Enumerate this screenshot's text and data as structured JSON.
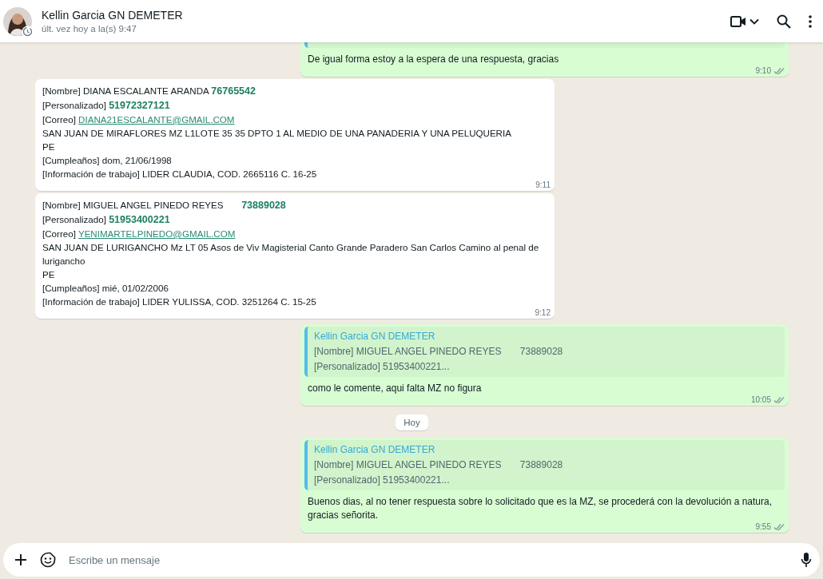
{
  "header": {
    "name": "Kellin Garcia GN DEMETER",
    "status": "últ. vez hoy a la(s) 9:47"
  },
  "messages": [
    {
      "kind": "message",
      "outgoing": true,
      "quote": {
        "partial": true
      },
      "lines": [
        {
          "text": "De igual forma estoy a la espera de una respuesta, gracias"
        }
      ],
      "time": "9:10",
      "read": false
    },
    {
      "kind": "message",
      "outgoing": false,
      "lines": [
        {
          "text": "[Nombre] DIANA ESCALANTE ARANDA **76765542**"
        },
        {
          "text": "[Personalizado] **51972327121**"
        },
        {
          "text": "[Correo] ",
          "link": "DIANA21ESCALANTE@GMAIL.COM"
        },
        {
          "text": "SAN JUAN DE MIRAFLORES MZ L1LOTE 35 35 DPTO 1 AL MEDIO DE UNA PANADERIA Y UNA PELUQUERIA"
        },
        {
          "text": "PE"
        },
        {
          "text": "[Cumpleaños] dom, 21/06/1998"
        },
        {
          "text": "[Información de trabajo] LIDER CLAUDIA, COD. 2665116 C. 16-25"
        }
      ],
      "time": "9:11"
    },
    {
      "kind": "message",
      "outgoing": false,
      "lines": [
        {
          "text": "[Nombre] MIGUEL ANGEL PINEDO REYES       **73889028**"
        },
        {
          "text": "[Personalizado] **51953400221**"
        },
        {
          "text": "[Correo] ",
          "link": "YENIMARTELPINEDO@GMAIL.COM"
        },
        {
          "text": "SAN JUAN DE LURIGANCHO Mz LT 05 Asos de Viv Magisterial Canto Grande Paradero San Carlos Camino al penal de lurigancho"
        },
        {
          "text": "PE"
        },
        {
          "text": "[Cumpleaños] mié, 01/02/2006"
        },
        {
          "text": "[Información de trabajo] LIDER YULISSA, COD. 3251264 C. 15-25"
        }
      ],
      "time": "9:12"
    },
    {
      "kind": "message",
      "outgoing": true,
      "quote": {
        "author": "Kellin Garcia GN DEMETER",
        "lines": [
          "[Nombre] MIGUEL ANGEL PINEDO REYES       73889028",
          "[Personalizado] 51953400221..."
        ]
      },
      "lines": [
        {
          "text": "como le comente, aqui falta MZ no figura"
        }
      ],
      "time": "10:05",
      "read": false
    },
    {
      "kind": "date",
      "label": "Hoy"
    },
    {
      "kind": "message",
      "outgoing": true,
      "quote": {
        "author": "Kellin Garcia GN DEMETER",
        "lines": [
          "[Nombre] MIGUEL ANGEL PINEDO REYES       73889028",
          "[Personalizado] 51953400221..."
        ]
      },
      "lines": [
        {
          "text": "Buenos dias, al no tener respuesta sobre lo solicitado que es la MZ, se procederá con la devolución a natura, gracias señorita."
        }
      ],
      "time": "9:55",
      "read": false
    }
  ],
  "composer": {
    "placeholder": "Escribe un mensaje"
  }
}
